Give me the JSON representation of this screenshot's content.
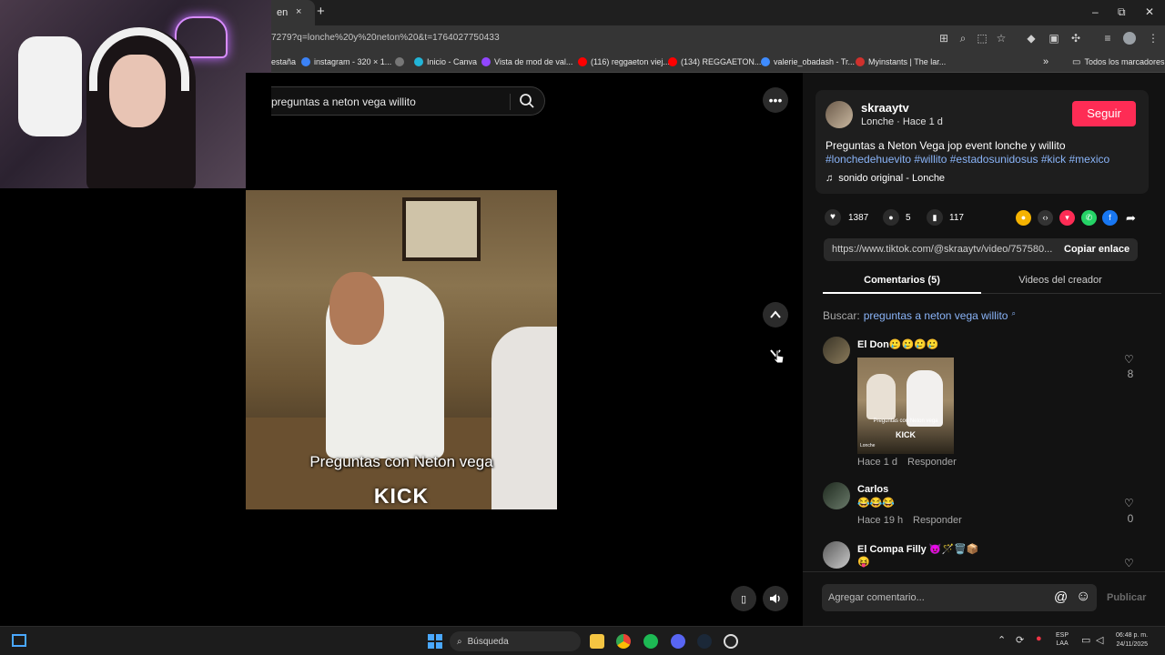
{
  "browser": {
    "tab_title": "en",
    "tab_close": "×",
    "new_tab": "+",
    "url": "7279?q=lonche%20y%20neton%20&t=1764027750433",
    "window_min": "–",
    "window_max": "⧉",
    "window_close": "✕",
    "bookmarks": [
      {
        "label": "estaña",
        "color": "#000000"
      },
      {
        "label": "instagram - 320 × 1...",
        "color": "#3b82f6"
      },
      {
        "label": "",
        "color": "#777777"
      },
      {
        "label": "Inicio - Canva",
        "color": "#22b5d8"
      },
      {
        "label": "Vista de mod de val...",
        "color": "#9146ff"
      },
      {
        "label": "(116) reggaeton viej...",
        "color": "#ff0000"
      },
      {
        "label": "(134) REGGAETON...",
        "color": "#ff0000"
      },
      {
        "label": "valerie_obadash - Tr...",
        "color": "#3f8cff"
      },
      {
        "label": "Myinstants | The lar...",
        "color": "#d0312d"
      }
    ],
    "bookmarks_more": "»",
    "all_bookmarks": "Todos los marcadores"
  },
  "search": {
    "query": "preguntas a neton vega willito"
  },
  "video": {
    "caption": "Preguntas con Neton vega",
    "watermark": "KICK"
  },
  "post": {
    "username": "skraaytv",
    "subtitle": "Lonche · Hace 1 d",
    "follow_label": "Seguir",
    "description": "Preguntas a Neton Vega jop event lonche y willito",
    "hashtags": "#lonchedehuevito #willito #estadosunidosus #kick #mexico",
    "sound": "sonido original - Lonche",
    "likes": "1387",
    "comments": "5",
    "saves": "117",
    "link": "https://www.tiktok.com/@skraaytv/video/757580...",
    "copy_link_label": "Copiar enlace",
    "tab_comments": "Comentarios (5)",
    "tab_creator": "Videos del creador",
    "search_label": "Buscar:",
    "search_link": "preguntas a neton vega willito"
  },
  "comments": [
    {
      "name": "El Don🥲🥲🥲🥲",
      "time": "Hace 1 d",
      "reply": "Responder",
      "likes": "8",
      "thumb_caption": "Preguntas con Neton vega",
      "thumb_watermark": "KICK",
      "thumb_user": "Lonche"
    },
    {
      "name": "Carlos",
      "text": "😂😂😂",
      "time": "Hace 19 h",
      "reply": "Responder",
      "likes": "0"
    },
    {
      "name": "El Compa Filly 😈🪄🗑️📦",
      "text": "😝"
    }
  ],
  "comment_bar": {
    "placeholder": "Agregar comentario...",
    "mention": "@",
    "emoji": "☺",
    "publish": "Publicar"
  },
  "taskbar": {
    "search_label": "Búsqueda",
    "lang_top": "ESP",
    "lang_bottom": "LAA",
    "time": "06:48 p. m.",
    "date": "24/11/2025"
  }
}
